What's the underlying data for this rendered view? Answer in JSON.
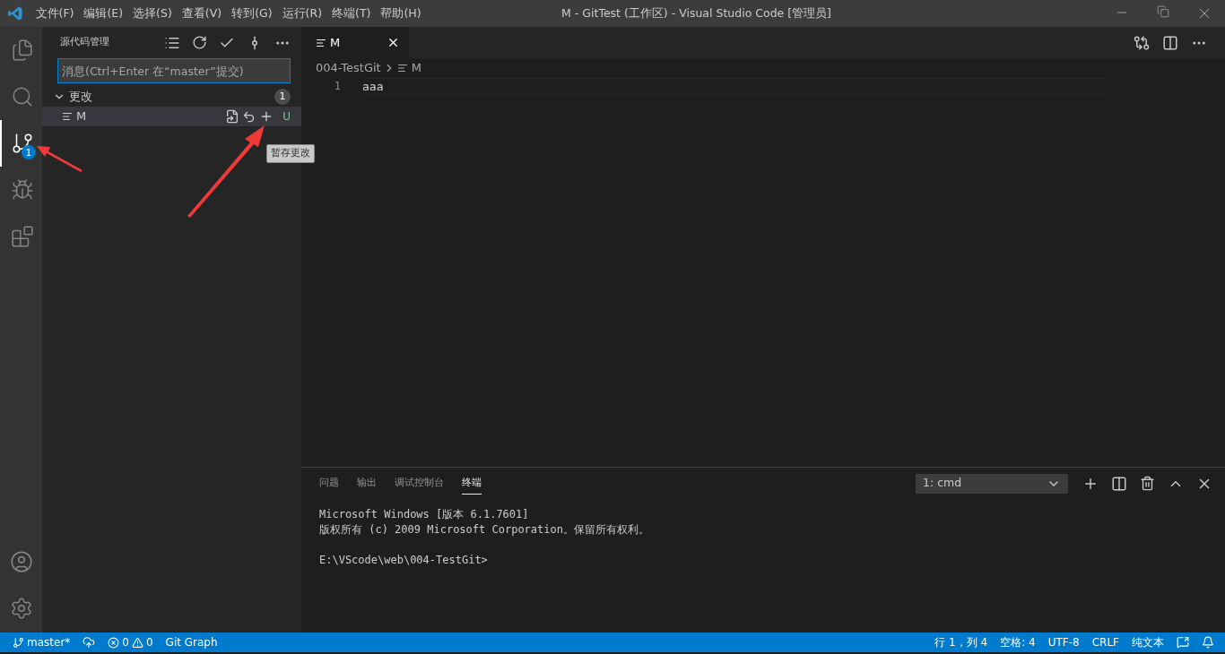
{
  "menu": [
    "文件(F)",
    "编辑(E)",
    "选择(S)",
    "查看(V)",
    "转到(G)",
    "运行(R)",
    "终端(T)",
    "帮助(H)"
  ],
  "window": {
    "title": "M - GitTest (工作区) - Visual Studio Code [管理员]"
  },
  "activity_bar": [
    {
      "kind": "files",
      "selected": false
    },
    {
      "kind": "search",
      "selected": false
    },
    {
      "kind": "scm",
      "selected": true,
      "badge": "1"
    },
    {
      "kind": "debug",
      "selected": false
    },
    {
      "kind": "extensions",
      "selected": false
    }
  ],
  "sidebar": {
    "title": "源代码管理",
    "commit_message": {
      "placeholder": "消息(Ctrl+Enter 在“master”提交)"
    },
    "group": {
      "label": "更改",
      "expanded": true,
      "count": "1",
      "files": [
        {
          "name": "M",
          "status": "U"
        }
      ]
    },
    "tooltip": "暂存更改"
  },
  "editor": {
    "tab": "M",
    "breadcrumbs": [
      "004-TestGit",
      "M"
    ],
    "lines": [
      {
        "number": "1",
        "text": "aaa"
      }
    ]
  },
  "panel": {
    "tabs": [
      {
        "label": "问题",
        "selected": false
      },
      {
        "label": "输出",
        "selected": false
      },
      {
        "label": "调试控制台",
        "selected": false
      },
      {
        "label": "终端",
        "selected": true
      }
    ],
    "terminal_select": "1: cmd",
    "terminal_blocks": [
      [
        "Microsoft Windows [版本 6.1.7601]",
        "版权所有 (c) 2009 Microsoft Corporation。保留所有权利。"
      ],
      [
        "E:\\VScode\\web\\004-TestGit>"
      ]
    ]
  },
  "status_bar": {
    "branch": "master*",
    "errors": "0",
    "warnings": "0",
    "git_graph": "Git Graph",
    "right": [
      "行 1，列 4",
      "空格: 4",
      "UTF-8",
      "CRLF",
      "纯文本"
    ]
  }
}
